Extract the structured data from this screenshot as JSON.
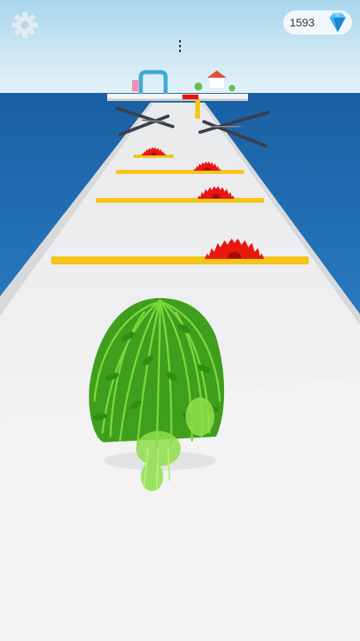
{
  "hud": {
    "gem_count": "1593",
    "gem_icon": "diamond-icon",
    "settings_icon": "gear-icon"
  },
  "colors": {
    "sky_top": "#a9d6ec",
    "sea": "#1f6fb6",
    "track": "#f2f2f2",
    "barrier": "#f5c518",
    "saw": "#e8170f",
    "hair": "#58c62a",
    "gem": "#2da3f0"
  }
}
